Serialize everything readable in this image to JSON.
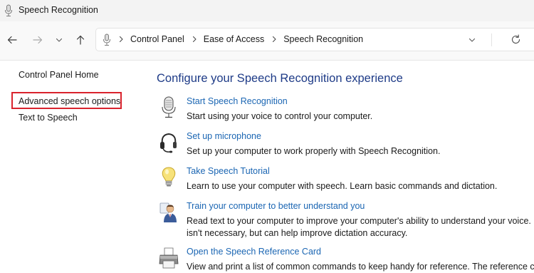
{
  "window": {
    "title": "Speech Recognition"
  },
  "breadcrumbs": [
    "Control Panel",
    "Ease of Access",
    "Speech Recognition"
  ],
  "sidebar": {
    "items": [
      {
        "label": "Control Panel Home"
      },
      {
        "label": "Advanced speech options",
        "highlighted": true
      },
      {
        "label": "Text to Speech"
      }
    ]
  },
  "main": {
    "title": "Configure your Speech Recognition experience",
    "tasks": [
      {
        "icon": "microphone-icon",
        "link": "Start Speech Recognition",
        "desc": [
          "Start using your voice to control your computer."
        ]
      },
      {
        "icon": "headset-icon",
        "link": "Set up microphone",
        "desc": [
          "Set up your computer to work properly with Speech Recognition."
        ]
      },
      {
        "icon": "lightbulb-icon",
        "link": "Take Speech Tutorial",
        "desc": [
          "Learn to use your computer with speech.  Learn basic commands and dictation."
        ]
      },
      {
        "icon": "user-training-icon",
        "link": "Train your computer to better understand you",
        "desc": [
          "Read text to your computer to improve your computer's ability to understand your voice.  Do",
          "isn't necessary, but can help improve dictation accuracy."
        ]
      },
      {
        "icon": "printer-icon",
        "link": "Open the Speech Reference Card",
        "desc": [
          "View and print a list of common commands to keep handy for reference. The reference card"
        ]
      }
    ]
  },
  "colors": {
    "link": "#1b66b3",
    "heading": "#1e3b87",
    "highlight_border": "#d9232d"
  }
}
